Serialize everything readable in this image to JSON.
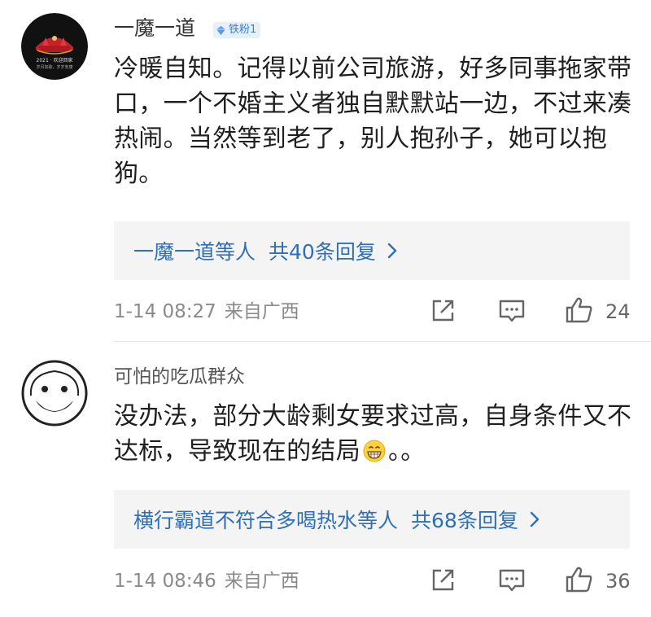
{
  "comments": [
    {
      "username": "一魔一道",
      "badge": "铁粉1",
      "avatar_text_line1": "2021 · 欢迎回家",
      "avatar_text_line2": "岁月如歌，岁岁安康",
      "text": "冷暖自知。记得以前公司旅游，好多同事拖家带口，一个不婚主义者独自默默站一边，不过来凑热闹。当然等到老了，别人抱孙子，她可以抱狗。",
      "replies_who": "一魔一道等人",
      "replies_count": "共40条回复",
      "time": "1-14 08:27",
      "location": "来自广西",
      "likes": "24"
    },
    {
      "username": "可怕的吃瓜群众",
      "text_before": "没办法，部分大龄剩女要求过高，自身条件又不达标，导致现在的结局",
      "text_after": "。。",
      "replies_who": "横行霸道不符合多喝热水等人",
      "replies_count": "共68条回复",
      "time": "1-14 08:46",
      "location": "来自广西",
      "likes": "36"
    }
  ],
  "icons": {
    "share": "share-icon",
    "comment": "comment-icon",
    "like": "thumbs-up-icon",
    "chevron": "chevron-right-icon",
    "emoji": "grinning-face-emoji"
  },
  "colors": {
    "link_blue": "#2f6fb6",
    "reply_bg": "#f4f4f4",
    "meta_gray": "#8a8a8a"
  }
}
